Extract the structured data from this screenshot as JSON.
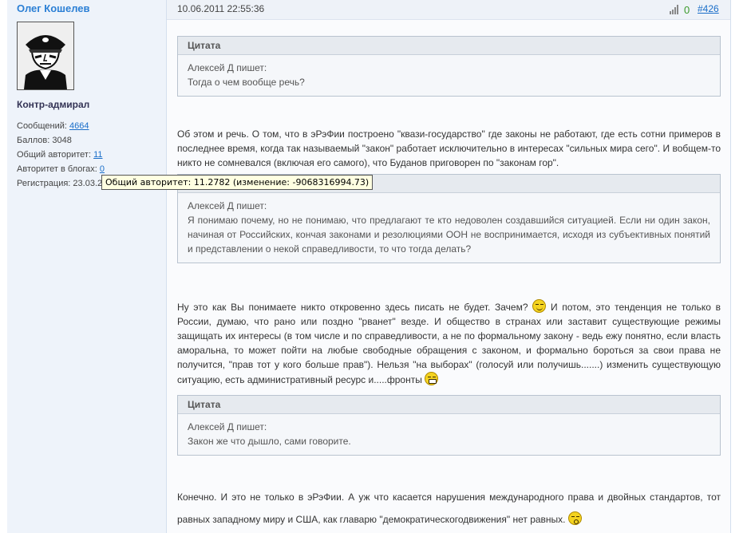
{
  "user": {
    "name": "Олег Кошелев",
    "rank": "Контр-адмирал",
    "stats": [
      {
        "label": "Сообщений:",
        "value": "4664",
        "link": true
      },
      {
        "label": "Баллов:",
        "value": "3048",
        "link": false
      },
      {
        "label": "Общий авторитет:",
        "value": "11",
        "link": true
      },
      {
        "label": "Авторитет в блогах:",
        "value": "0",
        "link": true
      },
      {
        "label": "Регистрация:",
        "value": "23.03.2",
        "link": false
      }
    ]
  },
  "tooltip": "Общий авторитет: 11.2782 (изменение:  -9068316994.73)",
  "post": {
    "date": "10.06.2011 22:55:36",
    "rating": "0",
    "number": "#426",
    "blocks": [
      {
        "type": "quote",
        "head": "Цитата",
        "author": "Алексей Д пишет:",
        "text": "Тогда о чем вообще речь?"
      },
      {
        "type": "para",
        "text": "Об этом и речь. О том, что в эРэФии построено \"квази-государство\" где законы не работают, где есть сотни примеров в последнее время, когда так называемый \"закон\" работает исключительно в интересах \"сильных мира сего\". И вобщем-то никто не сомневался (включая его самого), что Буданов приговорен по \"законам гор\"."
      },
      {
        "type": "quote",
        "head": "Цитата",
        "author": "Алексей Д пишет:",
        "text": "Я понимаю почему, но не понимаю, что предлагают те кто недоволен создавшийся ситуацией. Если ни один закон, начиная от Российских, кончая законами и резолюциями ООН не воспринимается, исходя из субъективных понятий и представлении о некой справедливости, то что тогда делать?"
      },
      {
        "type": "para",
        "text1": "Ну это как Вы понимаете никто откровенно здесь писать не будет. Зачем? ",
        "text2": " И потом, это тенденция не только в России, думаю, что рано или поздно \"рванет\" везде. И общество в странах или заставит существующие режимы защищать их интересы (в том числе и по справедливости, а не по формальному закону - ведь ежу понятно, если власть аморальна, то может пойти на любые свободные обращения с законом, и формально бороться за свои права не получится, \"прав тот у кого больше прав\"). Нельзя \"на выборах\" (голосуй или получишь.......) изменить существующую ситуацию, есть административный ресурс и.....фронты "
      },
      {
        "type": "quote",
        "head": "Цитата",
        "author": "Алексей Д пишет:",
        "text": "Закон же что дышло, сами говорите."
      },
      {
        "type": "para",
        "text": "Конечно. И это не только в эРэФии. А уж что касается нарушения международного права и двойных стандартов, тот равных западному миру и США, как главарю \"демократическогодвижения\" нет равных. "
      }
    ]
  }
}
